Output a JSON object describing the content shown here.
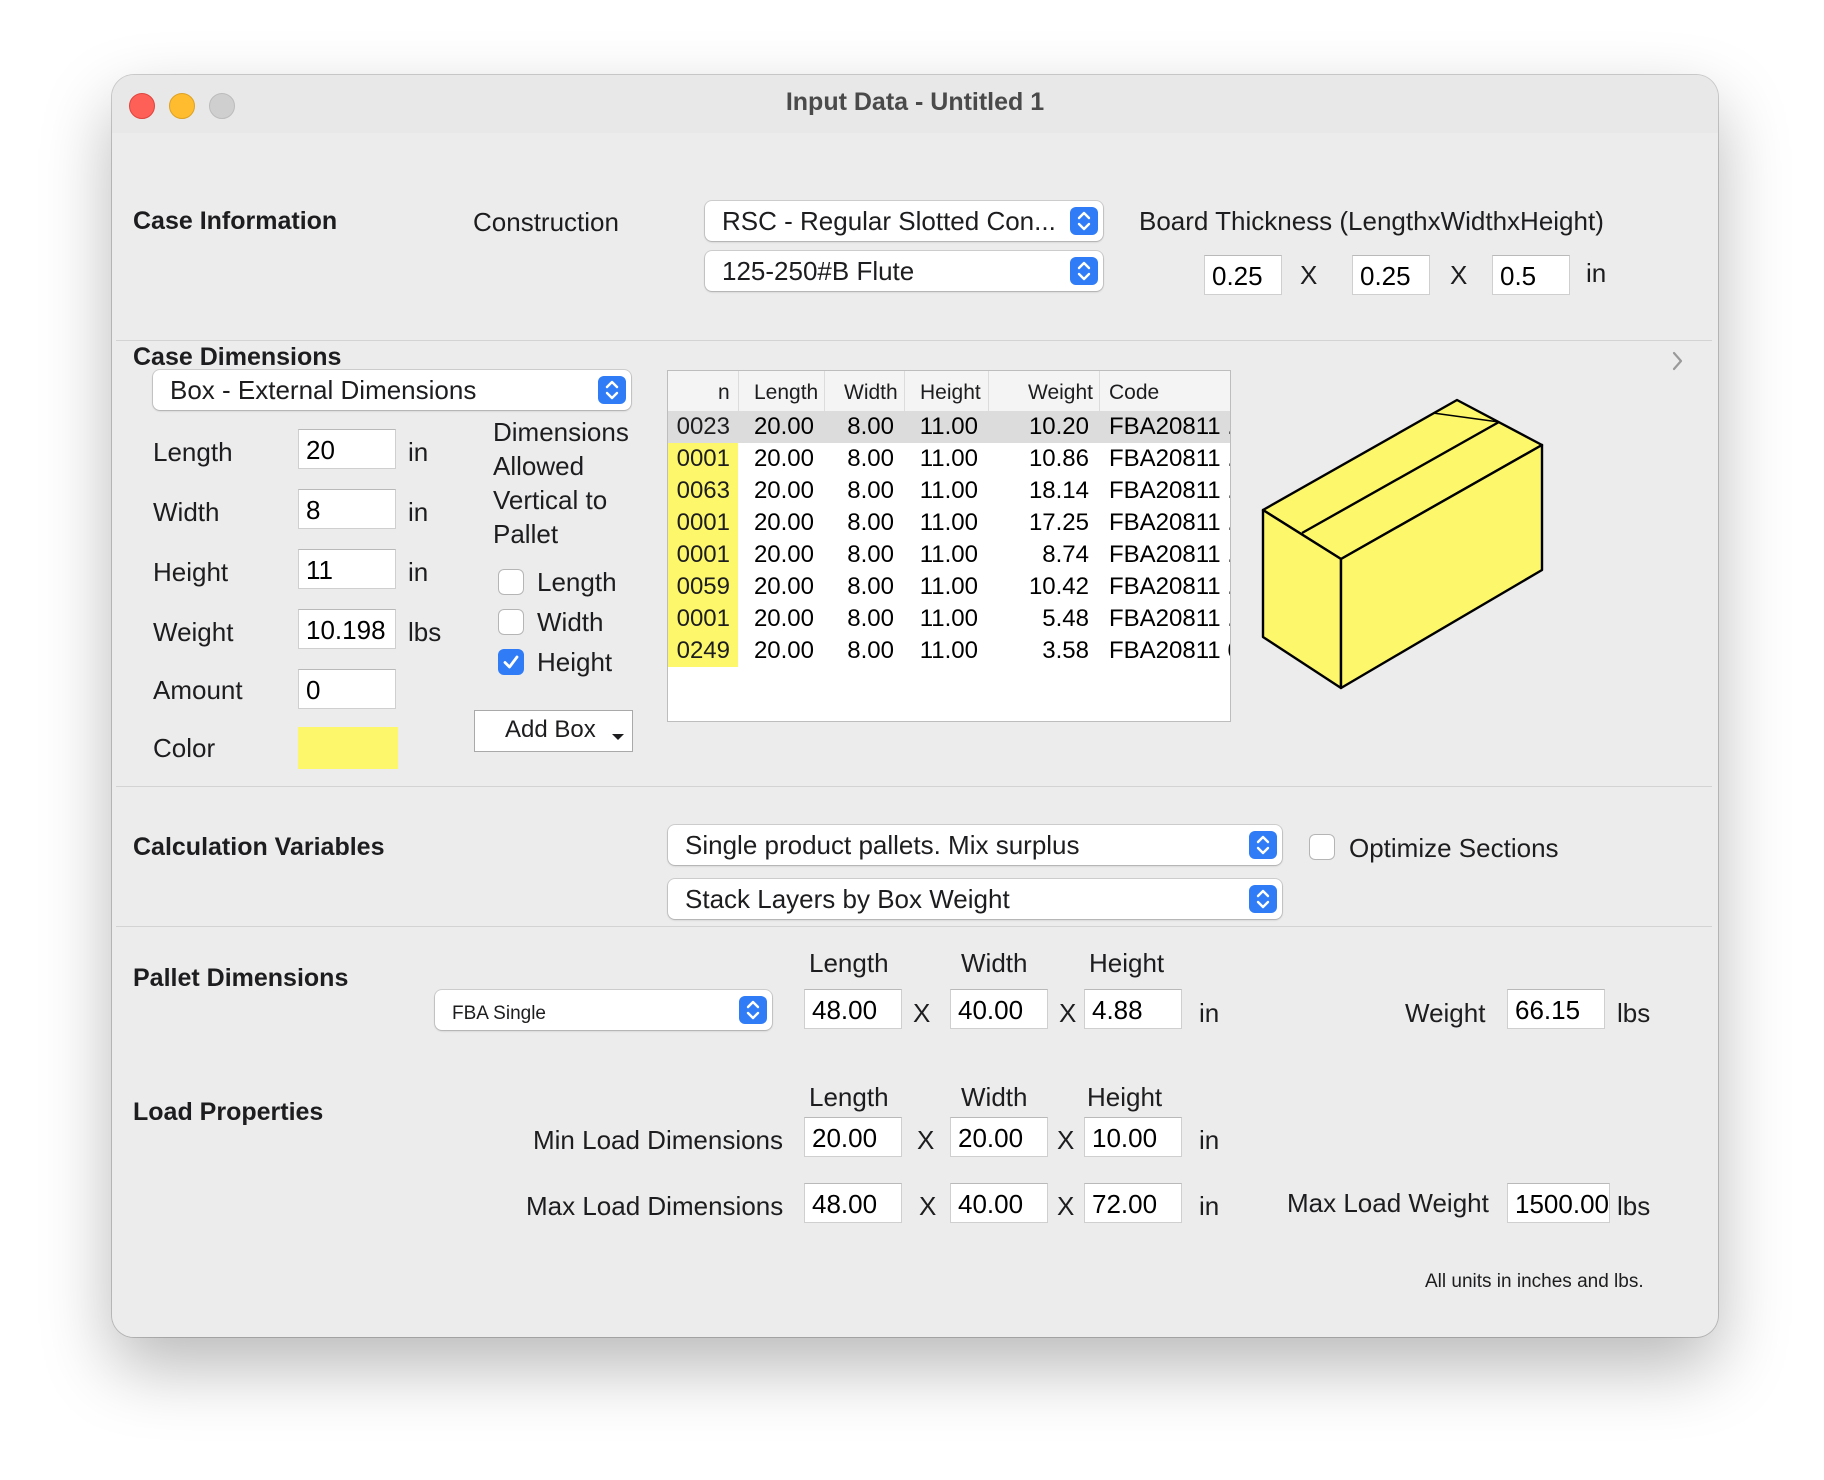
{
  "window": {
    "title": "Input Data - Untitled 1"
  },
  "case_information": {
    "heading": "Case Information",
    "construction_label": "Construction",
    "construction_value": "RSC - Regular Slotted Con...",
    "flute_value": "125-250#B Flute",
    "board_label": "Board Thickness (LengthxWidthxHeight)",
    "board_length": "0.25",
    "board_width": "0.25",
    "board_height": "0.5",
    "x": "X",
    "unit": "in"
  },
  "case_dimensions": {
    "heading": "Case Dimensions",
    "mode_value": "Box - External Dimensions",
    "length_label": "Length",
    "length_value": "20",
    "width_label": "Width",
    "width_value": "8",
    "height_label": "Height",
    "height_value": "11",
    "weight_label": "Weight",
    "weight_value": "10.198",
    "amount_label": "Amount",
    "amount_value": "0",
    "color_label": "Color",
    "color_hex": "#fdf86b",
    "unit_in": "in",
    "unit_lbs": "lbs",
    "vertical_text": [
      "Dimensions",
      "Allowed",
      "Vertical to",
      "Pallet"
    ],
    "vertical_length": {
      "label": "Length",
      "checked": false
    },
    "vertical_width": {
      "label": "Width",
      "checked": false
    },
    "vertical_height": {
      "label": "Height",
      "checked": true
    },
    "add_box_label": "Add Box"
  },
  "box_table": {
    "columns": [
      "n",
      "Length",
      "Width",
      "Height",
      "Weight",
      "Code"
    ],
    "rows": [
      {
        "n": "0023",
        "length": "20.00",
        "width": "8.00",
        "height": "11.00",
        "weight": "10.20",
        "code": "FBA20811 ..",
        "selected": true
      },
      {
        "n": "0001",
        "length": "20.00",
        "width": "8.00",
        "height": "11.00",
        "weight": "10.86",
        "code": "FBA20811 ..",
        "selected": false
      },
      {
        "n": "0063",
        "length": "20.00",
        "width": "8.00",
        "height": "11.00",
        "weight": "18.14",
        "code": "FBA20811 ..",
        "selected": false
      },
      {
        "n": "0001",
        "length": "20.00",
        "width": "8.00",
        "height": "11.00",
        "weight": "17.25",
        "code": "FBA20811 ..",
        "selected": false
      },
      {
        "n": "0001",
        "length": "20.00",
        "width": "8.00",
        "height": "11.00",
        "weight": "8.74",
        "code": "FBA20811 ..",
        "selected": false
      },
      {
        "n": "0059",
        "length": "20.00",
        "width": "8.00",
        "height": "11.00",
        "weight": "10.42",
        "code": "FBA20811 ..",
        "selected": false
      },
      {
        "n": "0001",
        "length": "20.00",
        "width": "8.00",
        "height": "11.00",
        "weight": "5.48",
        "code": "FBA20811 ..",
        "selected": false
      },
      {
        "n": "0249",
        "length": "20.00",
        "width": "8.00",
        "height": "11.00",
        "weight": "3.58",
        "code": "FBA20811 6",
        "selected": false
      }
    ],
    "highlight_color": "#fdf86b"
  },
  "calculation_variables": {
    "heading": "Calculation Variables",
    "mode_value": "Single product pallets. Mix surplus",
    "stack_value": "Stack Layers by Box Weight",
    "optimize_label": "Optimize Sections",
    "optimize_checked": false
  },
  "pallet_dimensions": {
    "heading": "Pallet Dimensions",
    "type_value": "FBA Single",
    "length_label": "Length",
    "width_label": "Width",
    "height_label": "Height",
    "length_value": "48.00",
    "width_value": "40.00",
    "height_value": "4.88",
    "x": "X",
    "unit_in": "in",
    "weight_label": "Weight",
    "weight_value": "66.15",
    "unit_lbs": "lbs"
  },
  "load_properties": {
    "heading": "Load Properties",
    "length_label": "Length",
    "width_label": "Width",
    "height_label": "Height",
    "min_label": "Min Load Dimensions",
    "min_length": "20.00",
    "min_width": "20.00",
    "min_height": "10.00",
    "max_label": "Max Load Dimensions",
    "max_length": "48.00",
    "max_width": "40.00",
    "max_height": "72.00",
    "x": "X",
    "unit_in": "in",
    "max_weight_label": "Max Load Weight",
    "max_weight_value": "1500.00",
    "unit_lbs": "lbs"
  },
  "footer_note": "All units in inches and lbs."
}
